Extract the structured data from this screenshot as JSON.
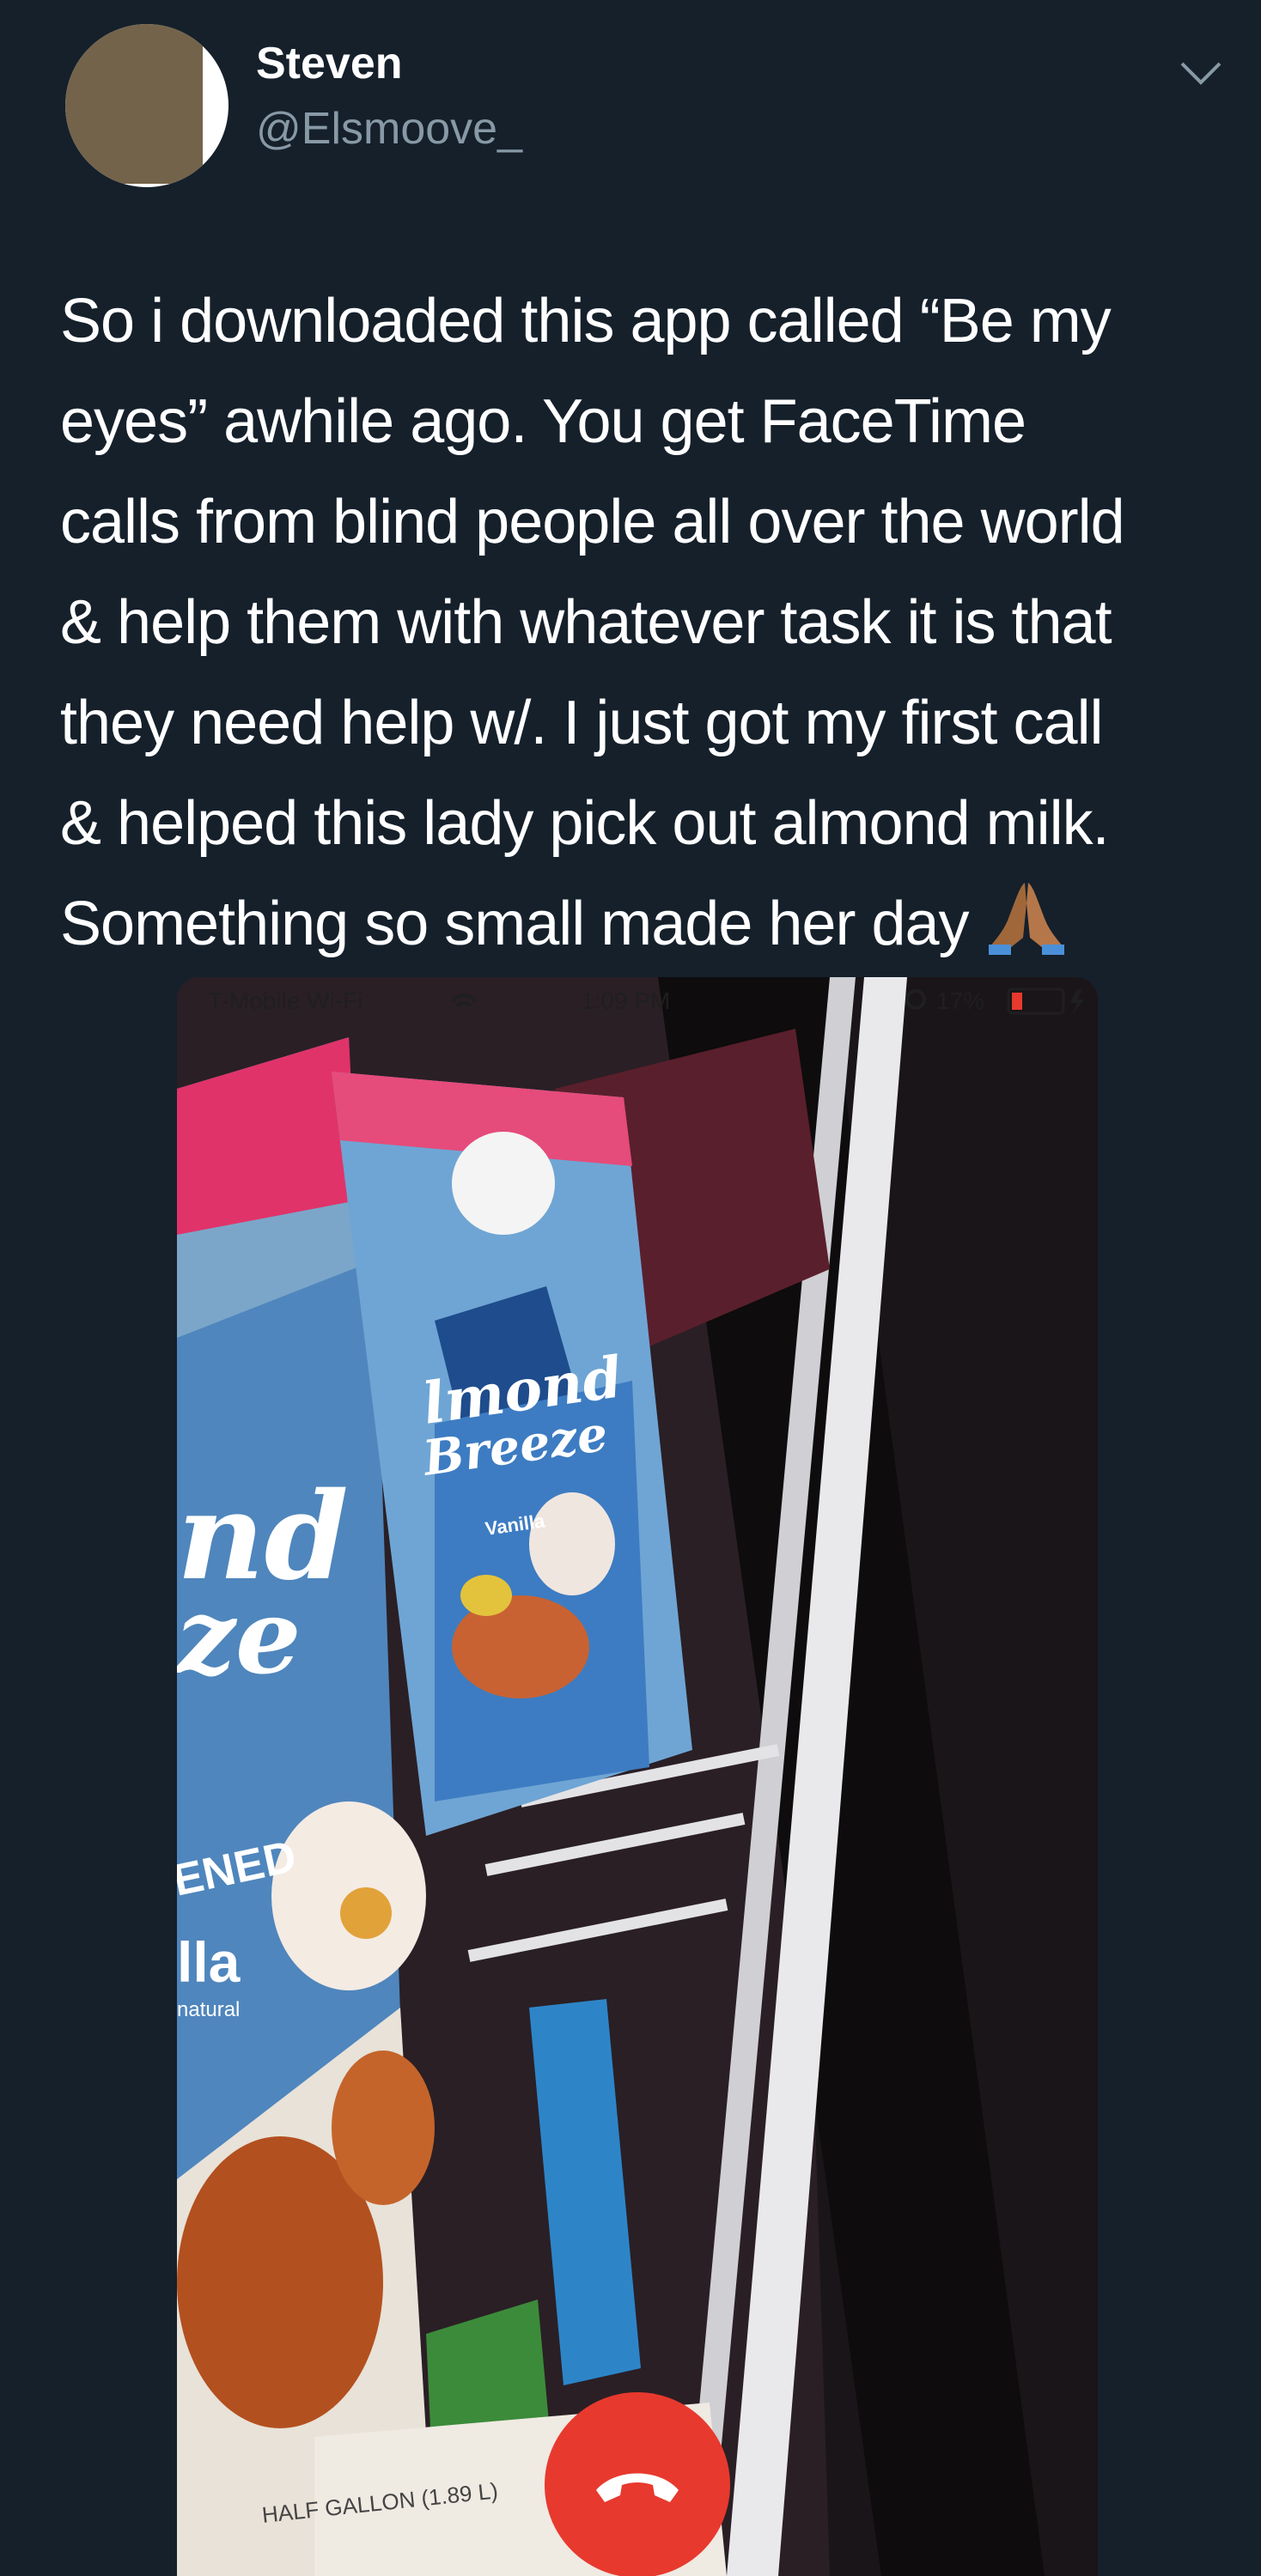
{
  "tweet": {
    "author": {
      "display_name": "Steven",
      "handle": "@Elsmoove_"
    },
    "text": "So i downloaded this app called “Be my eyes” awhile ago. You get FaceTime calls from blind people all over the world & help them with whatever task it is that they need help w/. I just got my first call & helped this lady pick out almond milk. Something so small made her day",
    "text_lines": [
      "So i downloaded this app called “Be my",
      "eyes” awhile ago. You get FaceTime",
      "calls from blind people all over the world",
      "& help them with whatever task it is that",
      "they need help w/. I just got my first call",
      "& helped this lady pick out almond milk.",
      "Something so small made her day"
    ],
    "trailing_emoji": "folded-hands-emoji",
    "menu_icon": "chevron-down-icon"
  },
  "media": {
    "status_bar": {
      "carrier": "T-Mobile Wi-Fi",
      "time": "1:09 PM",
      "battery": "17%"
    },
    "product_text": {
      "left_carton": [
        "nd",
        "ze",
        "ENED",
        "lla",
        "natural"
      ],
      "center_carton": [
        "lmond",
        "Breeze",
        "Vanilla"
      ],
      "bottom_label": "HALF GALLON (1.89 L)"
    },
    "end_call_icon": "phone-hangup-icon",
    "colors": {
      "end_call": "#e8392e",
      "background": "#15202b",
      "handle": "#8899a6"
    }
  }
}
